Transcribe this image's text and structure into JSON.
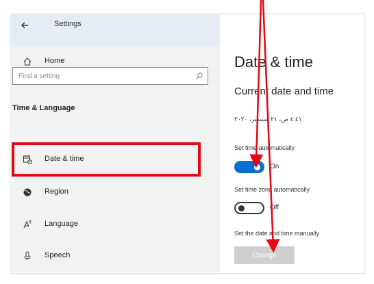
{
  "window": {
    "title": "Settings"
  },
  "sidebar": {
    "home_label": "Home",
    "search_placeholder": "Find a setting",
    "section_title": "Time & Language",
    "items": [
      {
        "label": "Date & time",
        "icon": "calendar-clock-icon"
      },
      {
        "label": "Region",
        "icon": "globe-icon"
      },
      {
        "label": "Language",
        "icon": "language-icon"
      },
      {
        "label": "Speech",
        "icon": "microphone-icon"
      }
    ]
  },
  "main": {
    "title": "Date & time",
    "subtitle": "Current date and time",
    "current_datetime": "٤:٤١ ص، ٢١ سبتمبر، ٢٠٢٠",
    "set_time_auto": {
      "label": "Set time automatically",
      "state": "On"
    },
    "set_timezone_auto": {
      "label": "Set time zone automatically",
      "state": "Off"
    },
    "set_manual": {
      "label": "Set the date and time manually",
      "button": "Change"
    }
  },
  "colors": {
    "accent": "#0a6ed1",
    "highlight": "#e30613",
    "sidebar_bg": "#f2f2f2",
    "disabled_button": "#cfcfcf"
  }
}
